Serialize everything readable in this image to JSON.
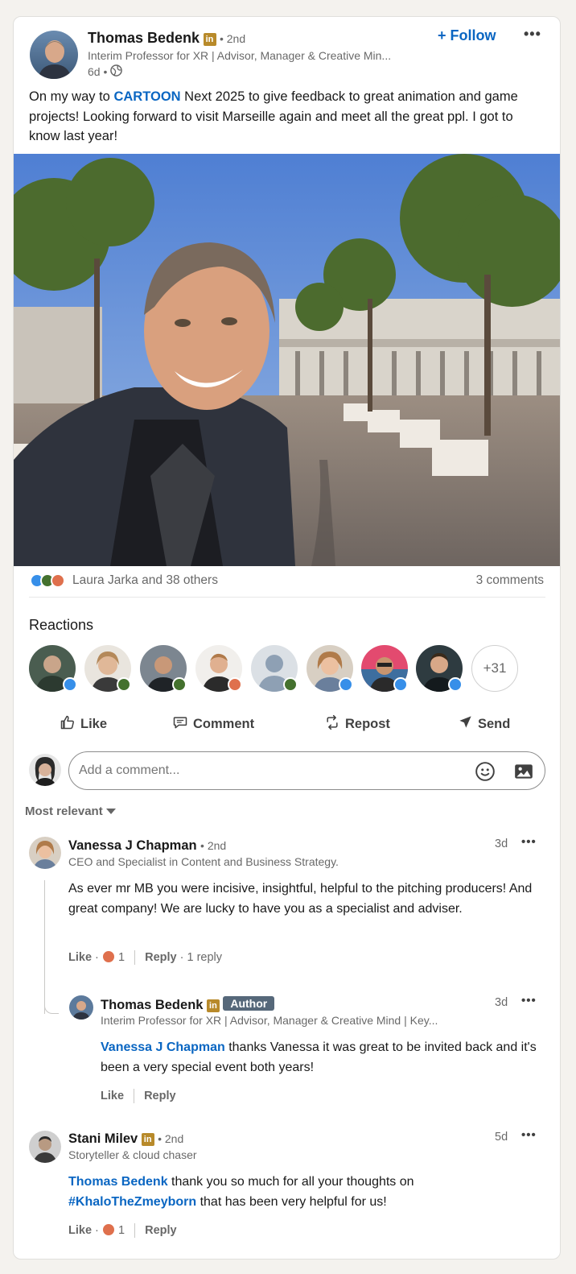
{
  "post": {
    "author_name": "Thomas Bedenk",
    "author_degree": "• 2nd",
    "author_headline": "Interim Professor for XR | Advisor, Manager & Creative Min...",
    "time": "6d •",
    "follow_label": "+ Follow",
    "text_before": "On my way to ",
    "text_link": "CARTOON",
    "text_after": " Next 2025 to give feedback to great animation and game projects! Looking forward to visit Marseille again and meet all the great ppl. I got to know last year!",
    "reactions_text": "Laura Jarka and 38 others",
    "comments_count": "3 comments"
  },
  "reactions": {
    "heading": "Reactions",
    "more_count": "+31"
  },
  "actions": {
    "like": "Like",
    "comment": "Comment",
    "repost": "Repost",
    "send": "Send"
  },
  "comment_box": {
    "placeholder": "Add a comment..."
  },
  "sort": {
    "label": "Most relevant"
  },
  "comments": [
    {
      "name": "Vanessa J Chapman",
      "degree": "• 2nd",
      "headline": "CEO and Specialist in Content and Business Strategy.",
      "time": "3d",
      "text": "As ever mr MB you were incisive, insightful, helpful to the pitching producers! And great company! We are lucky to have you as a specialist and adviser.",
      "like": "Like",
      "dot": "·",
      "reaction_count": "1",
      "reply": "Reply",
      "replies": "· 1 reply"
    },
    {
      "name": "Thomas Bedenk",
      "badge": "Author",
      "headline": "Interim Professor for XR | Advisor, Manager & Creative Mind | Key...",
      "time": "3d",
      "mention": "Vanessa J Chapman",
      "text": " thanks Vanessa it was great to be invited back and it's been a very special event both years!",
      "like": "Like",
      "reply": "Reply"
    },
    {
      "name": "Stani Milev",
      "degree": "• 2nd",
      "headline": "Storyteller & cloud chaser",
      "time": "5d",
      "mention": "Thomas Bedenk",
      "text_mid": " thank you so much for all your thoughts on ",
      "hashtag": "#KhaloTheZmeyborn",
      "text_end": " that has been very helpful for us!",
      "like": "Like",
      "dot": "·",
      "reaction_count": "1",
      "reply": "Reply"
    }
  ],
  "colors": {
    "link": "#0a66c2",
    "like": "#378fe9",
    "celebrate": "#44712e",
    "love": "#df704d",
    "author_badge": "#56687a"
  }
}
